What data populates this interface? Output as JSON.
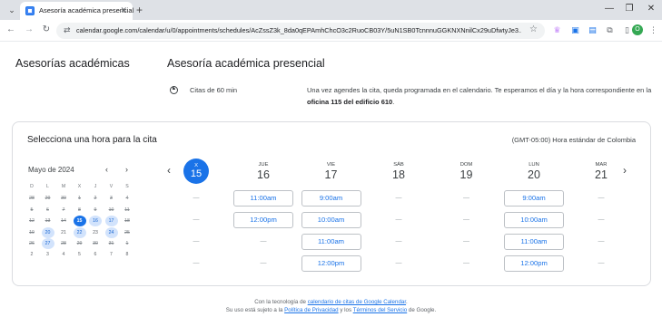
{
  "browser": {
    "tab_title": "Asesoría académica presencial",
    "url": "calendar.google.com/calendar/u/0/appointments/schedules/AcZssZ3k_8da0qEPAmhChcO3c2RuoCB03Y/5uN1SB0TcnnnuGGKNXNnilCx29uDfwtyJe3...",
    "avatar_letter": "O"
  },
  "page": {
    "left_title": "Asesorías académicas",
    "service_title": "Asesoría académica presencial",
    "duration": "Citas de 60 min",
    "description_pre": "Una vez agendes la cita, queda programada en el calendario. Te esperamos el día y la hora correspondiente en la ",
    "description_bold": "oficina 115 del edificio 610",
    "description_post": "."
  },
  "card": {
    "title": "Selecciona una hora para la cita",
    "timezone": "(GMT-05:00) Hora estándar de Colombia"
  },
  "mini_calendar": {
    "month": "Mayo de 2024",
    "weekdays": [
      "D",
      "L",
      "M",
      "X",
      "J",
      "V",
      "S"
    ],
    "weeks": [
      [
        {
          "d": "28",
          "s": "past"
        },
        {
          "d": "29",
          "s": "past"
        },
        {
          "d": "30",
          "s": "past"
        },
        {
          "d": "1",
          "s": "past"
        },
        {
          "d": "2",
          "s": "past"
        },
        {
          "d": "3",
          "s": "past"
        },
        {
          "d": "4",
          "s": "past"
        }
      ],
      [
        {
          "d": "5",
          "s": "past"
        },
        {
          "d": "6",
          "s": "past"
        },
        {
          "d": "7",
          "s": "past"
        },
        {
          "d": "8",
          "s": "past"
        },
        {
          "d": "9",
          "s": "past"
        },
        {
          "d": "10",
          "s": "past"
        },
        {
          "d": "11",
          "s": "past"
        }
      ],
      [
        {
          "d": "12",
          "s": "past"
        },
        {
          "d": "13",
          "s": "past"
        },
        {
          "d": "14",
          "s": "past"
        },
        {
          "d": "15",
          "s": "sel"
        },
        {
          "d": "16",
          "s": "avail"
        },
        {
          "d": "17",
          "s": "avail"
        },
        {
          "d": "18",
          "s": "past"
        }
      ],
      [
        {
          "d": "19",
          "s": "past"
        },
        {
          "d": "20",
          "s": "avail"
        },
        {
          "d": "21",
          "s": ""
        },
        {
          "d": "22",
          "s": "avail"
        },
        {
          "d": "23",
          "s": ""
        },
        {
          "d": "24",
          "s": "avail"
        },
        {
          "d": "25",
          "s": "past"
        }
      ],
      [
        {
          "d": "26",
          "s": "past"
        },
        {
          "d": "27",
          "s": "avail"
        },
        {
          "d": "28",
          "s": "past"
        },
        {
          "d": "29",
          "s": "past"
        },
        {
          "d": "30",
          "s": "past"
        },
        {
          "d": "31",
          "s": "past"
        },
        {
          "d": "1",
          "s": "past"
        }
      ],
      [
        {
          "d": "2",
          "s": ""
        },
        {
          "d": "3",
          "s": ""
        },
        {
          "d": "4",
          "s": ""
        },
        {
          "d": "5",
          "s": ""
        },
        {
          "d": "6",
          "s": ""
        },
        {
          "d": "7",
          "s": ""
        },
        {
          "d": "8",
          "s": ""
        }
      ]
    ]
  },
  "week": {
    "selected": {
      "name": "X",
      "num": "15"
    },
    "days": [
      {
        "name": "JUE",
        "num": "16",
        "slots": [
          "11:00am",
          "12:00pm"
        ]
      },
      {
        "name": "VIE",
        "num": "17",
        "slots": [
          "9:00am",
          "10:00am",
          "11:00am",
          "12:00pm"
        ]
      },
      {
        "name": "SÁB",
        "num": "18",
        "slots": []
      },
      {
        "name": "DOM",
        "num": "19",
        "slots": []
      },
      {
        "name": "LUN",
        "num": "20",
        "slots": [
          "9:00am",
          "10:00am",
          "11:00am",
          "12:00pm"
        ]
      },
      {
        "name": "MAR",
        "num": "21",
        "slots": []
      }
    ],
    "empty_mark": "—"
  },
  "footer": {
    "line1_pre": "Con la tecnología de ",
    "line1_link": "calendario de citas de Google Calendar",
    "line1_post": ".",
    "line2_pre": "Su uso está sujeto a la ",
    "line2_link1": "Política de Privacidad",
    "line2_mid": " y los ",
    "line2_link2": "Términos del Servicio",
    "line2_post": " de Google."
  },
  "colors": {
    "accent": "#1a73e8",
    "available_bg": "#d2e3fc"
  }
}
